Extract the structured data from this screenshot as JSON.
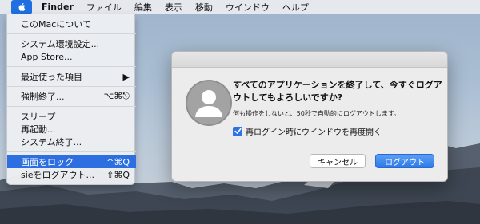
{
  "colors": {
    "accent": "#2d6fe0",
    "menubar_bg": "#e8eaee",
    "dialog_bg": "#ececec"
  },
  "menubar": {
    "apple_icon": "apple-logo-icon",
    "items": [
      "Finder",
      "ファイル",
      "編集",
      "表示",
      "移動",
      "ウインドウ",
      "ヘルプ"
    ]
  },
  "apple_menu": {
    "items": [
      {
        "label": "このMacについて",
        "shortcut": ""
      },
      {
        "label": "システム環境設定...",
        "shortcut": ""
      },
      {
        "label": "App Store...",
        "shortcut": ""
      },
      {
        "label": "最近使った項目",
        "shortcut": "▶"
      },
      {
        "label": "強制終了...",
        "shortcut": "⌥⌘⎋"
      },
      {
        "label": "スリープ",
        "shortcut": ""
      },
      {
        "label": "再起動...",
        "shortcut": ""
      },
      {
        "label": "システム終了...",
        "shortcut": ""
      },
      {
        "label": "画面をロック",
        "shortcut": "^⌘Q"
      },
      {
        "label": "sieをログアウト...",
        "shortcut": "⇧⌘Q"
      }
    ]
  },
  "dialog": {
    "title": "すべてのアプリケーションを終了して、今すぐログアウトしてもよろしいですか?",
    "message": "何も操作をしないと、50秒で自動的にログアウトします。",
    "checkbox_label": "再ログイン時にウインドウを再度開く",
    "checkbox_checked": true,
    "cancel_label": "キャンセル",
    "confirm_label": "ログアウト"
  }
}
